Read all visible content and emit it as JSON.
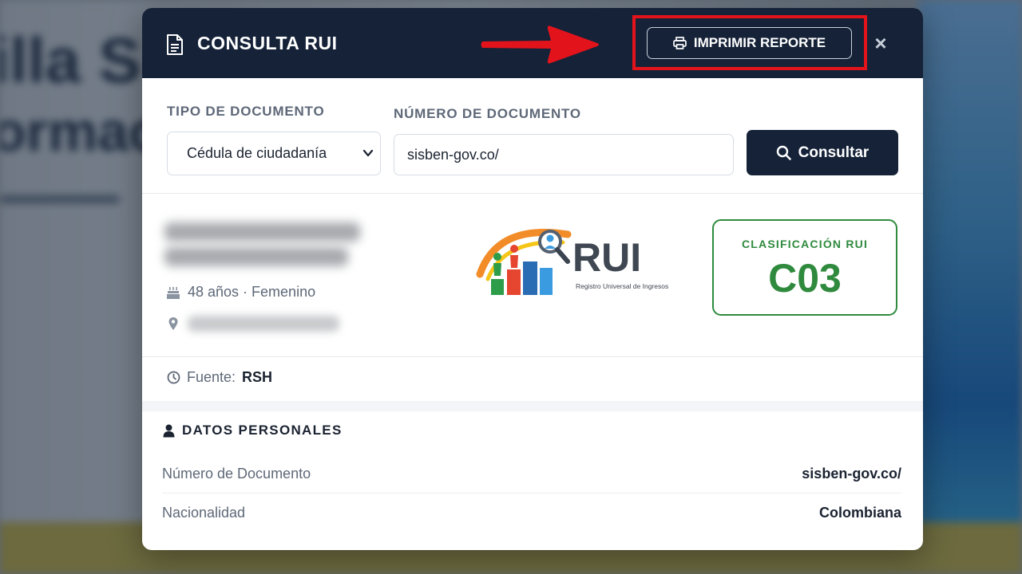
{
  "modal": {
    "title": "CONSULTA RUI",
    "print_label": "IMPRIMIR REPORTE",
    "close_label": "×"
  },
  "form": {
    "doc_type_label": "TIPO DE DOCUMENTO",
    "doc_type_value": "Cédula de ciudadanía",
    "doc_number_label": "NÚMERO DE DOCUMENTO",
    "doc_number_value": "sisben-gov.co/",
    "consult_label": "Consultar"
  },
  "profile": {
    "age_gender": "48 años · Femenino",
    "name_redacted": true,
    "location_redacted": true
  },
  "classification": {
    "label": "CLASIFICACIÓN RUI",
    "value": "C03",
    "color": "#2f8a3e"
  },
  "logo": {
    "title": "RUI",
    "subtitle": "Registro Universal de Ingresos"
  },
  "source": {
    "label": "Fuente:",
    "value": "RSH"
  },
  "personal": {
    "title": "DATOS PERSONALES",
    "rows": [
      {
        "key": "Número de Documento",
        "value": "sisben-gov.co/"
      },
      {
        "key": "Nacionalidad",
        "value": "Colombiana"
      }
    ]
  },
  "colors": {
    "header_bg": "#152238",
    "highlight": "#e3131b",
    "accent_green": "#2f8a3e"
  }
}
